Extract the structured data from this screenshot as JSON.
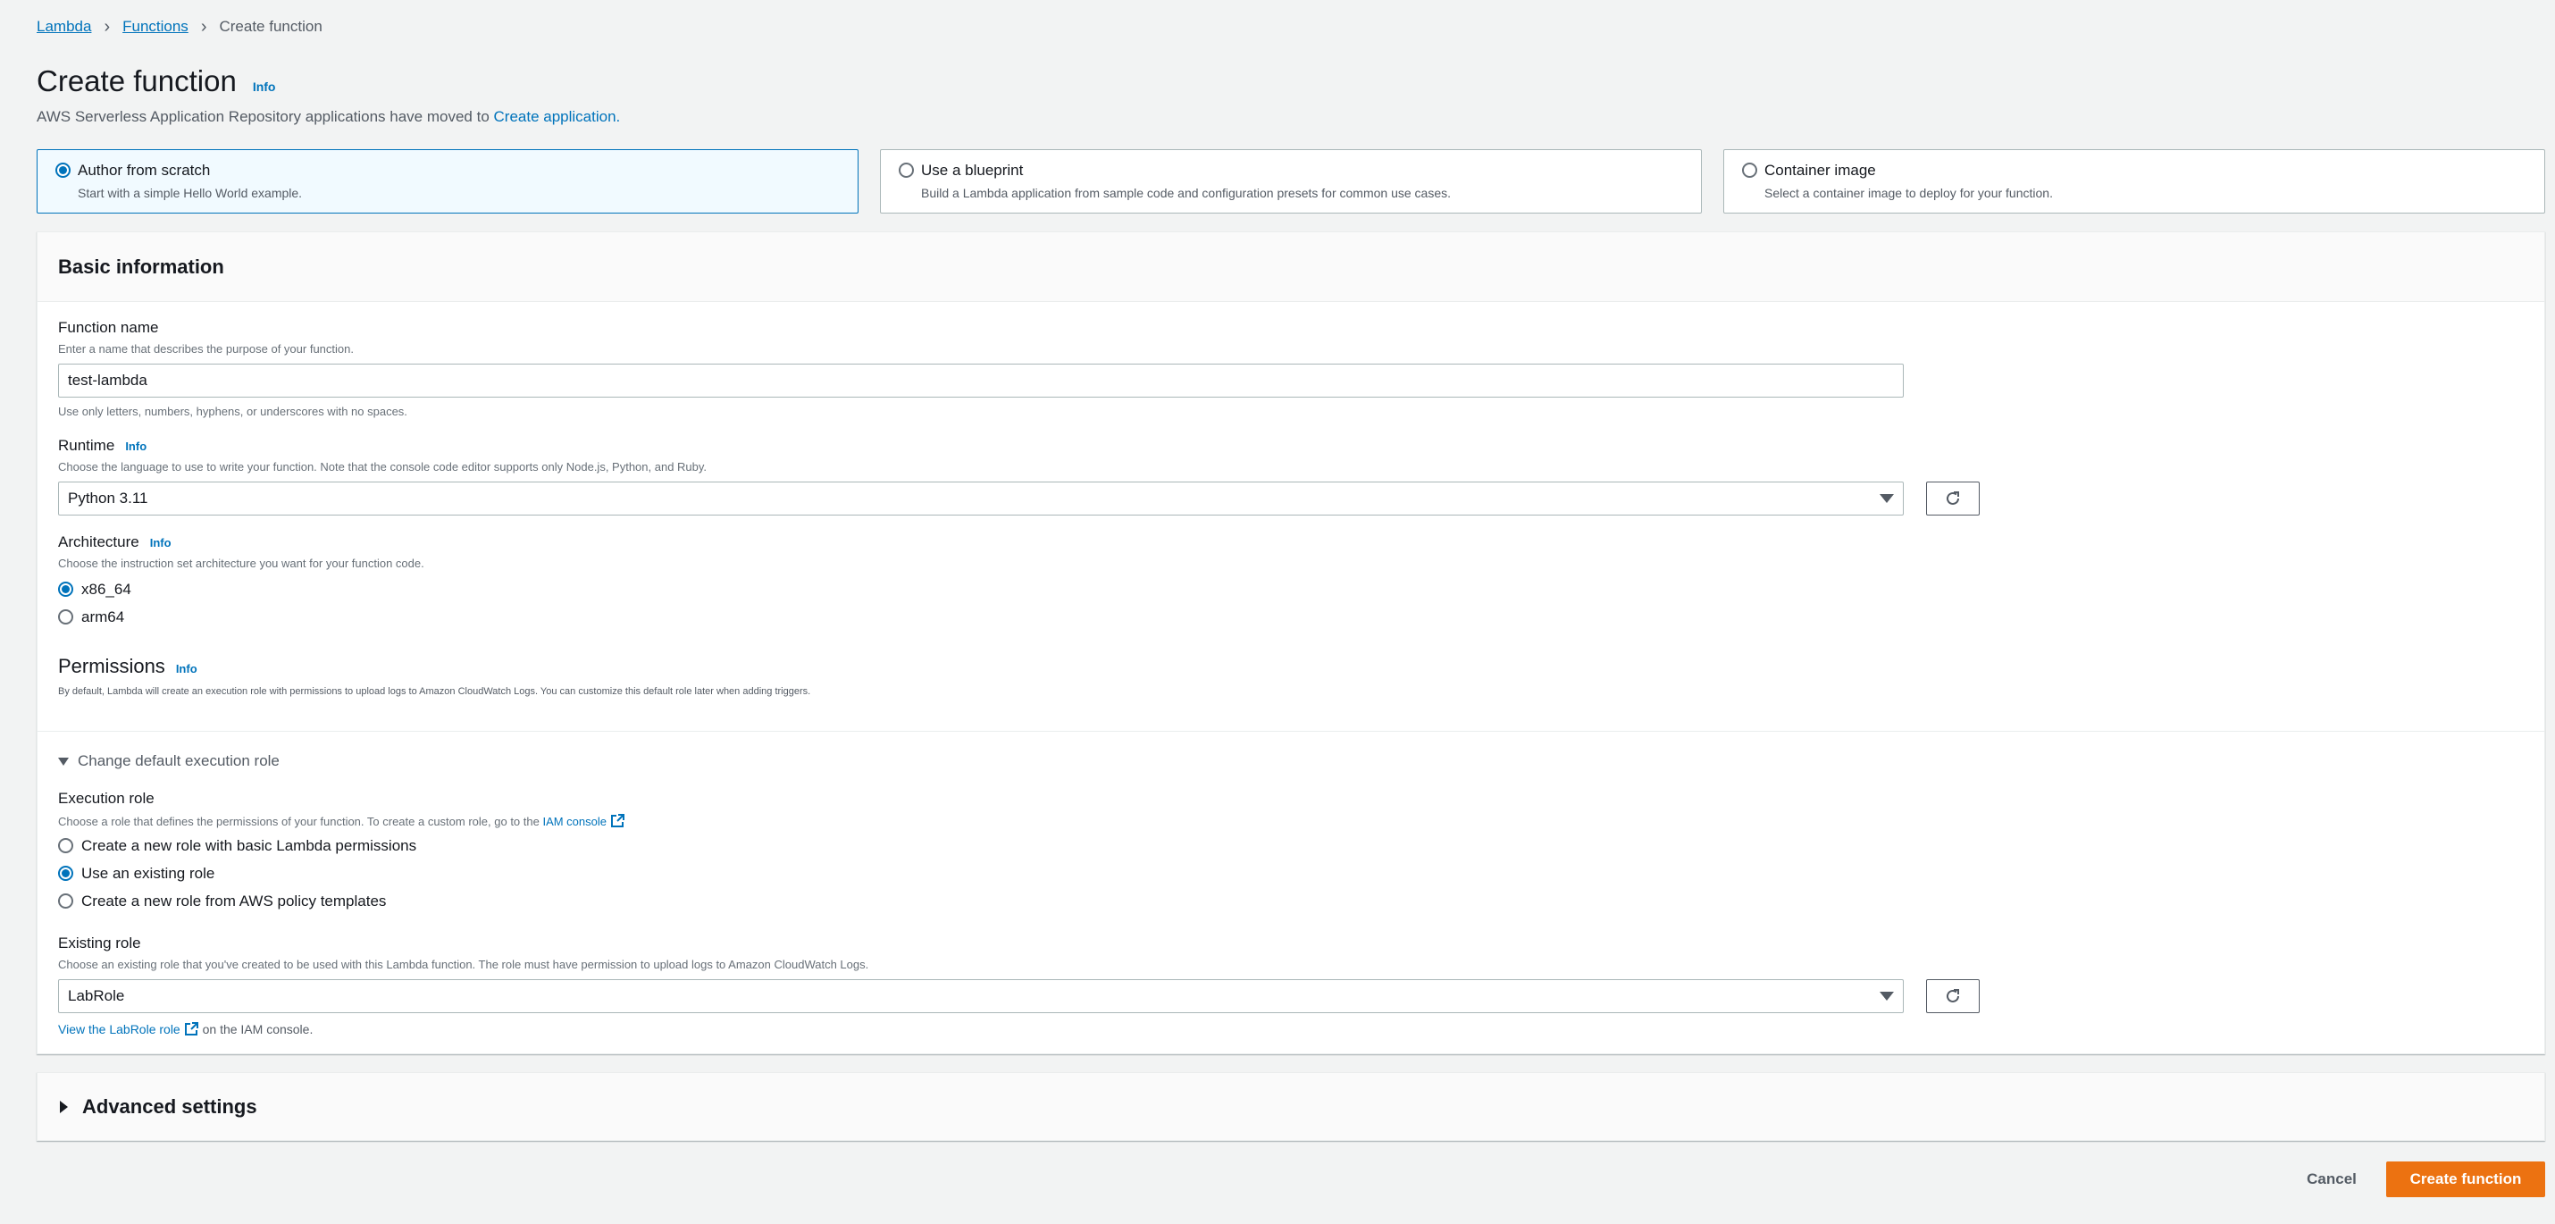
{
  "breadcrumb": {
    "items": [
      "Lambda",
      "Functions"
    ],
    "current": "Create function"
  },
  "header": {
    "title": "Create function",
    "info": "Info",
    "notice_text": "AWS Serverless Application Repository applications have moved to ",
    "notice_link": "Create application."
  },
  "options": [
    {
      "title": "Author from scratch",
      "desc": "Start with a simple Hello World example.",
      "selected": true
    },
    {
      "title": "Use a blueprint",
      "desc": "Build a Lambda application from sample code and configuration presets for common use cases.",
      "selected": false
    },
    {
      "title": "Container image",
      "desc": "Select a container image to deploy for your function.",
      "selected": false
    }
  ],
  "basic": {
    "title": "Basic information",
    "function_name": {
      "label": "Function name",
      "desc": "Enter a name that describes the purpose of your function.",
      "value": "test-lambda",
      "constraint": "Use only letters, numbers, hyphens, or underscores with no spaces."
    },
    "runtime": {
      "label": "Runtime",
      "info": "Info",
      "desc": "Choose the language to use to write your function. Note that the console code editor supports only Node.js, Python, and Ruby.",
      "value": "Python 3.11"
    },
    "architecture": {
      "label": "Architecture",
      "info": "Info",
      "desc": "Choose the instruction set architecture you want for your function code.",
      "options": [
        "x86_64",
        "arm64"
      ],
      "selected": "x86_64"
    },
    "permissions": {
      "title": "Permissions",
      "info": "Info",
      "desc": "By default, Lambda will create an execution role with permissions to upload logs to Amazon CloudWatch Logs. You can customize this default role later when adding triggers."
    },
    "change_role": {
      "label": "Change default execution role",
      "expanded": true
    },
    "execution_role": {
      "label": "Execution role",
      "desc": "Choose a role that defines the permissions of your function. To create a custom role, go to the ",
      "link": "IAM console",
      "options": [
        "Create a new role with basic Lambda permissions",
        "Use an existing role",
        "Create a new role from AWS policy templates"
      ],
      "selected": "Use an existing role"
    },
    "existing_role": {
      "label": "Existing role",
      "desc": "Choose an existing role that you've created to be used with this Lambda function. The role must have permission to upload logs to Amazon CloudWatch Logs.",
      "value": "LabRole",
      "view_link": "View the LabRole role",
      "view_suffix": " on the IAM console."
    }
  },
  "advanced": {
    "title": "Advanced settings",
    "expanded": false
  },
  "footer": {
    "cancel": "Cancel",
    "create": "Create function"
  },
  "colors": {
    "accent": "#0073bb",
    "primary_button": "#ec7211",
    "background": "#f2f3f3"
  }
}
